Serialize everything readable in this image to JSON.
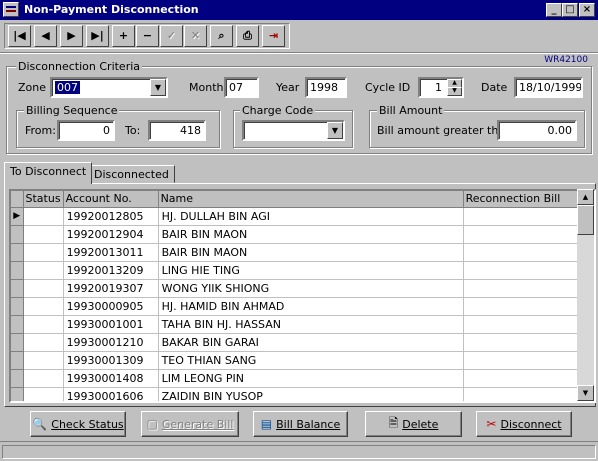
{
  "window": {
    "title": "Non-Payment Disconnection",
    "form_code": "WR42100"
  },
  "toolbar": {
    "first_label": "|◀",
    "prev_label": "◀",
    "next_label": "▶",
    "last_label": "▶|",
    "add_label": "+",
    "delete_label": "−",
    "save_label": "✓",
    "cancel_label": "✕",
    "find_label": "⌕",
    "print_label": "⎙",
    "exit_label": "⇥"
  },
  "criteria": {
    "legend": "Disconnection Criteria",
    "zone_label": "Zone",
    "zone_value": "007",
    "month_label": "Month",
    "month_value": "07",
    "year_label": "Year",
    "year_value": "1998",
    "cycle_label": "Cycle ID",
    "cycle_value": "1",
    "date_label": "Date",
    "date_value": "18/10/1999",
    "billing_legend": "Billing Sequence",
    "from_label": "From:",
    "from_value": "0",
    "to_label": "To:",
    "to_value": "418",
    "charge_legend": "Charge Code",
    "charge_value": "",
    "bill_amount_legend": "Bill Amount",
    "bill_amount_label": "Bill amount greater than:",
    "bill_amount_value": "0.00"
  },
  "tabs": [
    {
      "label": "To Disconnect",
      "active": true
    },
    {
      "label": "Disconnected",
      "active": false
    }
  ],
  "grid": {
    "columns": [
      "Status",
      "Account No.",
      "Name",
      "Reconnection Bill"
    ],
    "rows": [
      {
        "status": "",
        "account": "19920012805",
        "name": "HJ. DULLAH BIN AGI",
        "bill": ""
      },
      {
        "status": "",
        "account": "19920012904",
        "name": "BAIR BIN MAON",
        "bill": ""
      },
      {
        "status": "",
        "account": "19920013011",
        "name": "BAIR BIN MAON",
        "bill": ""
      },
      {
        "status": "",
        "account": "19920013209",
        "name": "LING HIE TING",
        "bill": ""
      },
      {
        "status": "",
        "account": "19920019307",
        "name": "WONG YIIK SHIONG",
        "bill": ""
      },
      {
        "status": "",
        "account": "19930000905",
        "name": "HJ. HAMID BIN AHMAD",
        "bill": ""
      },
      {
        "status": "",
        "account": "19930001001",
        "name": "TAHA BIN HJ. HASSAN",
        "bill": ""
      },
      {
        "status": "",
        "account": "19930001210",
        "name": "BAKAR BIN GARAI",
        "bill": ""
      },
      {
        "status": "",
        "account": "19930001309",
        "name": "TEO THIAN SANG",
        "bill": ""
      },
      {
        "status": "",
        "account": "19930001408",
        "name": "LIM LEONG PIN",
        "bill": ""
      },
      {
        "status": "",
        "account": "19930001606",
        "name": "ZAIDIN BIN YUSOP",
        "bill": ""
      }
    ]
  },
  "buttons": {
    "check_status": "Check Status",
    "generate_bill": "Generate Bill",
    "bill_balance": "Bill Balance",
    "delete": "Delete",
    "disconnect": "Disconnect"
  },
  "colors": {
    "titlebar": "#000080",
    "face": "#c0c0c0",
    "selection": "#000080"
  }
}
